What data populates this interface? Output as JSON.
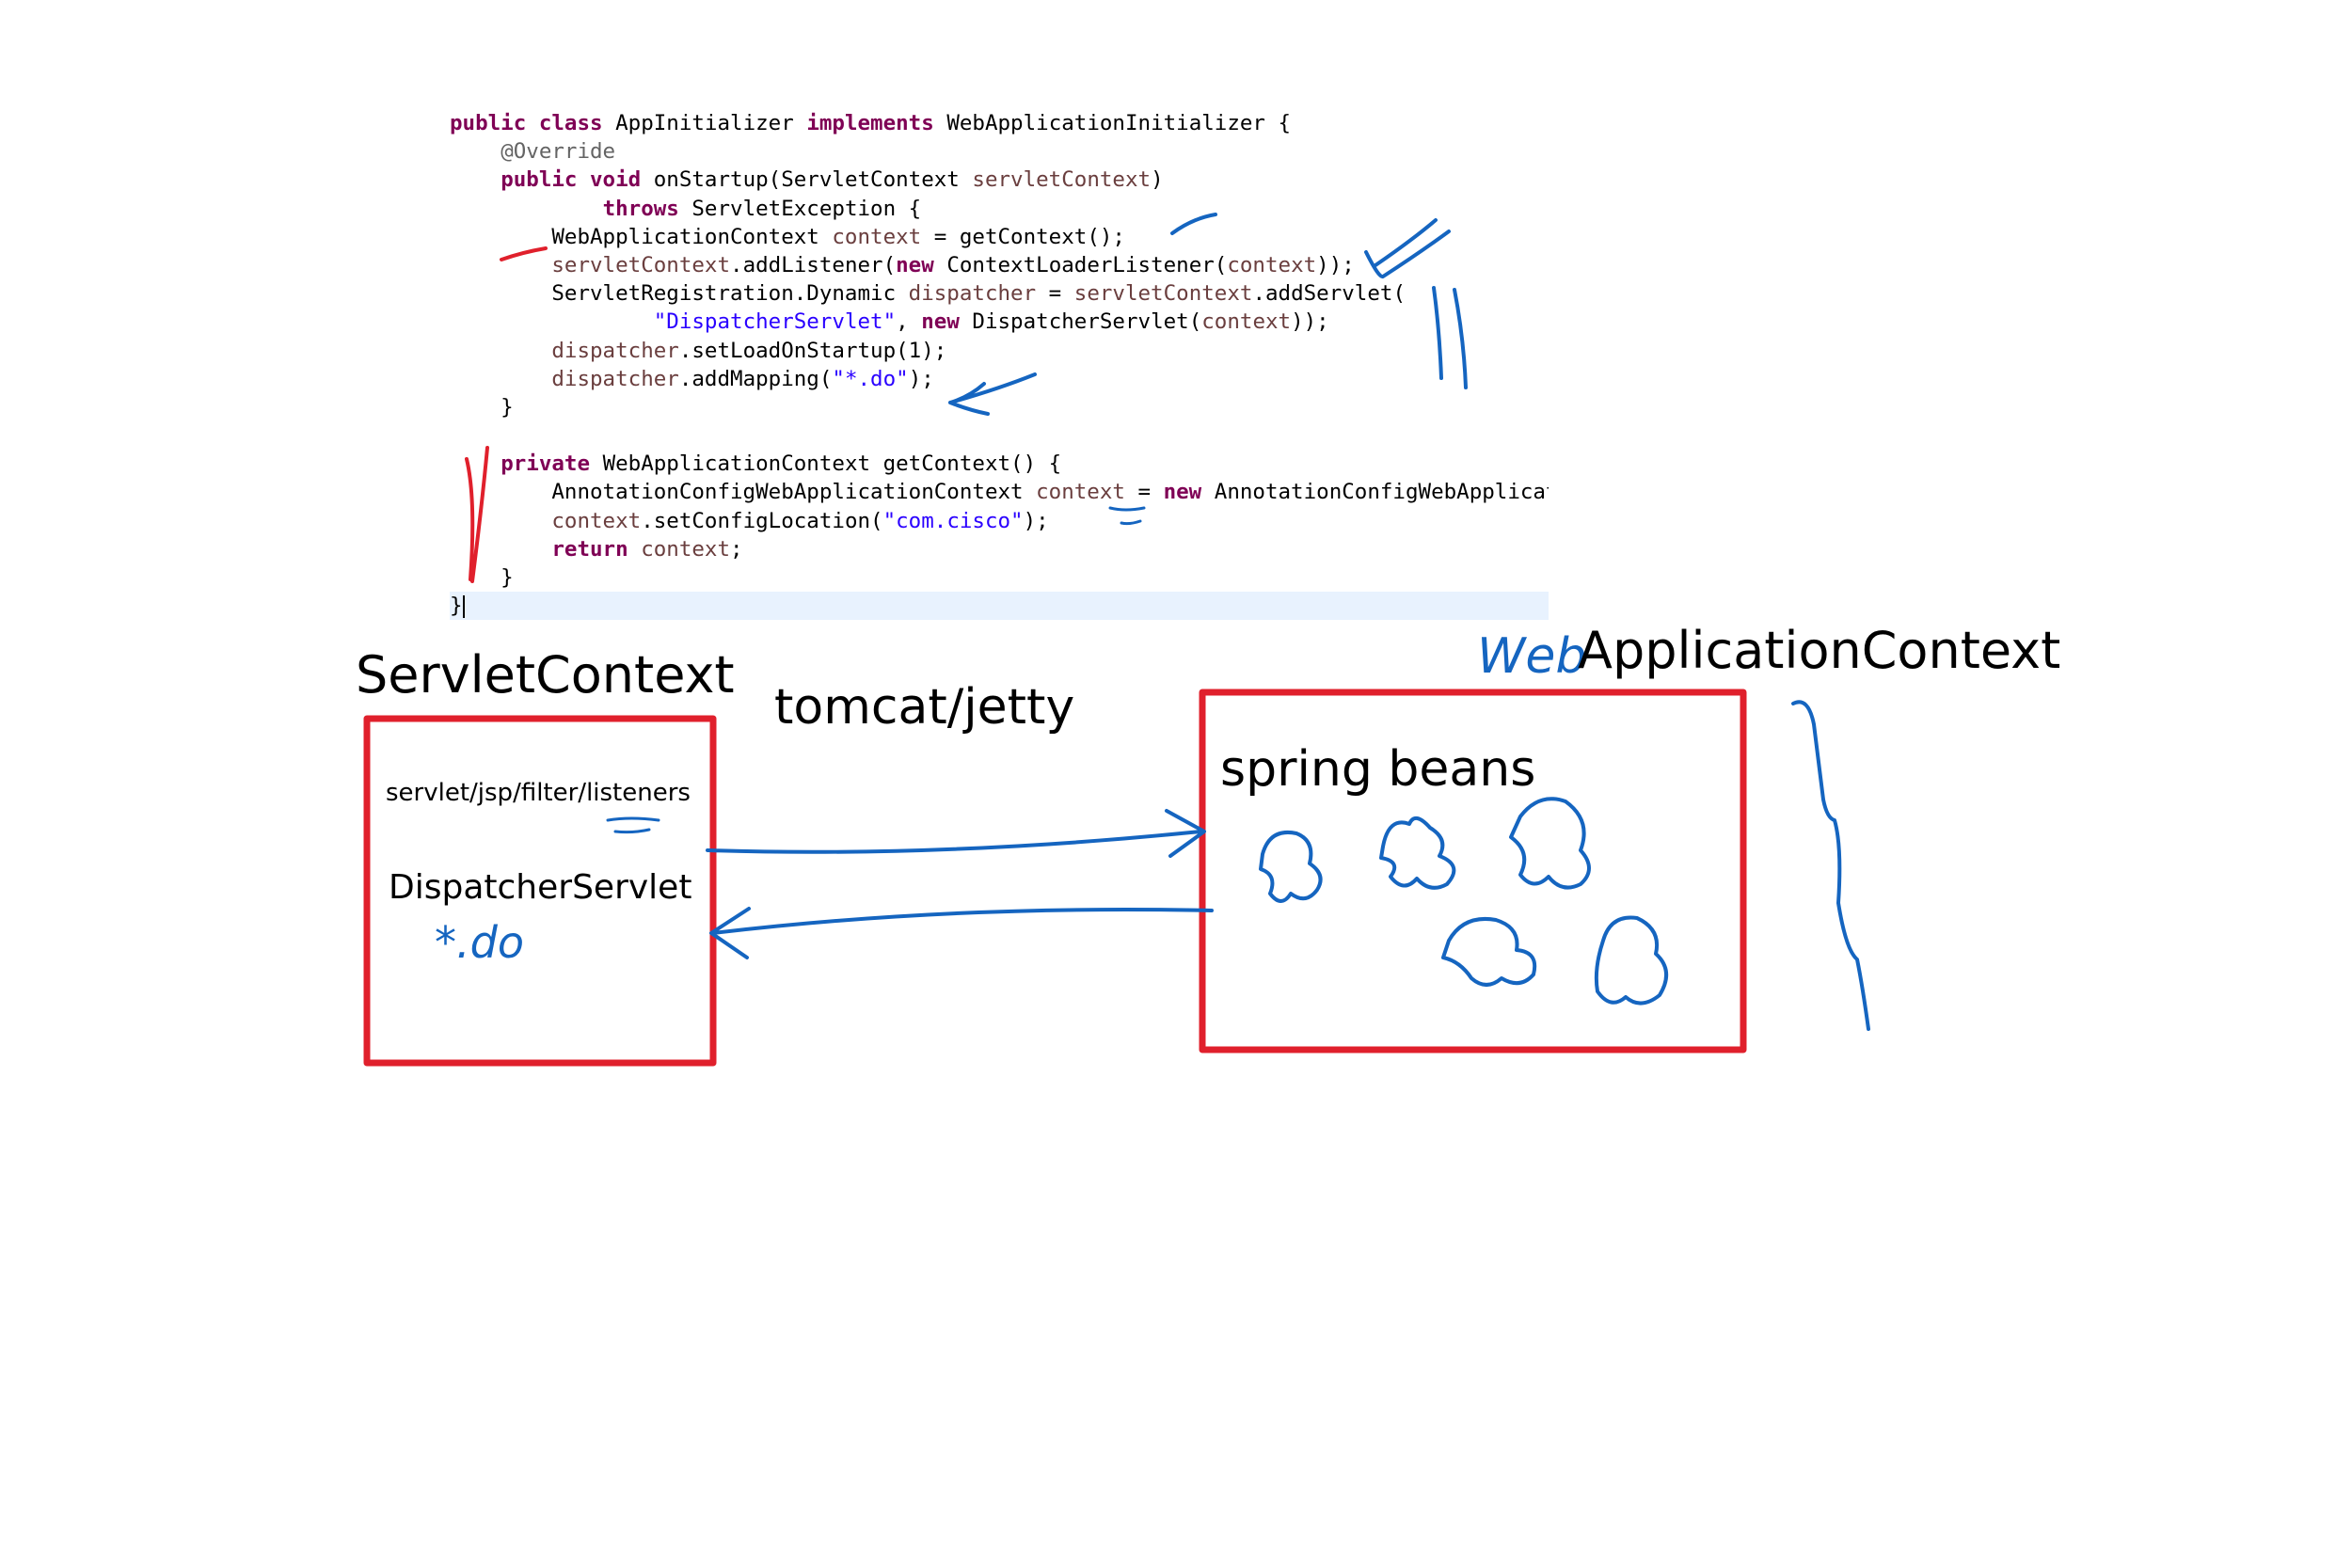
{
  "code": {
    "lines": [
      [
        {
          "t": "public ",
          "c": "kw"
        },
        {
          "t": "class ",
          "c": "kw"
        },
        {
          "t": "AppInitializer "
        },
        {
          "t": "implements ",
          "c": "kw"
        },
        {
          "t": "WebApplicationInitializer {"
        }
      ],
      [
        {
          "t": "    "
        },
        {
          "t": "@Override",
          "c": "ann"
        }
      ],
      [
        {
          "t": "    "
        },
        {
          "t": "public ",
          "c": "kw"
        },
        {
          "t": "void ",
          "c": "kw"
        },
        {
          "t": "onStartup(ServletContext "
        },
        {
          "t": "servletContext",
          "c": "var"
        },
        {
          "t": ")"
        }
      ],
      [
        {
          "t": "            "
        },
        {
          "t": "throws ",
          "c": "kw"
        },
        {
          "t": "ServletException {"
        }
      ],
      [
        {
          "t": "        WebApplicationContext "
        },
        {
          "t": "context",
          "c": "var"
        },
        {
          "t": " = getContext();"
        }
      ],
      [
        {
          "t": "        "
        },
        {
          "t": "servletContext",
          "c": "var"
        },
        {
          "t": ".addListener("
        },
        {
          "t": "new ",
          "c": "kw"
        },
        {
          "t": "ContextLoaderListener("
        },
        {
          "t": "context",
          "c": "var"
        },
        {
          "t": "));"
        }
      ],
      [
        {
          "t": "        ServletRegistration.Dynamic "
        },
        {
          "t": "dispatcher",
          "c": "var"
        },
        {
          "t": " = "
        },
        {
          "t": "servletContext",
          "c": "var"
        },
        {
          "t": ".addServlet("
        }
      ],
      [
        {
          "t": "                "
        },
        {
          "t": "\"DispatcherServlet\"",
          "c": "str"
        },
        {
          "t": ", "
        },
        {
          "t": "new ",
          "c": "kw"
        },
        {
          "t": "DispatcherServlet("
        },
        {
          "t": "context",
          "c": "var"
        },
        {
          "t": "));"
        }
      ],
      [
        {
          "t": "        "
        },
        {
          "t": "dispatcher",
          "c": "var"
        },
        {
          "t": ".setLoadOnStartup(1);"
        }
      ],
      [
        {
          "t": "        "
        },
        {
          "t": "dispatcher",
          "c": "var"
        },
        {
          "t": ".addMapping("
        },
        {
          "t": "\"*.do\"",
          "c": "str"
        },
        {
          "t": ");"
        }
      ],
      [
        {
          "t": "    }"
        }
      ],
      [
        {
          "t": ""
        }
      ],
      [
        {
          "t": "    "
        },
        {
          "t": "private ",
          "c": "kw"
        },
        {
          "t": "WebApplicationContext getContext() {"
        }
      ],
      [
        {
          "t": "        AnnotationConfigWebApplicationContext "
        },
        {
          "t": "context",
          "c": "var"
        },
        {
          "t": " = "
        },
        {
          "t": "new ",
          "c": "kw"
        },
        {
          "t": "AnnotationConfigWebApplicat"
        }
      ],
      [
        {
          "t": "        "
        },
        {
          "t": "context",
          "c": "var"
        },
        {
          "t": ".setConfigLocation("
        },
        {
          "t": "\"com.cisco\"",
          "c": "str"
        },
        {
          "t": ");"
        }
      ],
      [
        {
          "t": "        "
        },
        {
          "t": "return ",
          "c": "kw"
        },
        {
          "t": "context",
          "c": "var"
        },
        {
          "t": ";"
        }
      ],
      [
        {
          "t": "    }"
        }
      ],
      [
        {
          "t": "}"
        }
      ]
    ]
  },
  "diagram": {
    "servlet_context_title": "ServletContext",
    "container_label": "tomcat/jetty",
    "app_context_prefix": "Web",
    "app_context_title": "ApplicationContext",
    "servlet_context_items": "servlet/jsp/filter/listeners",
    "dispatcher_label": "DispatcherServlet",
    "mapping_note": "*.do",
    "beans_label": "spring beans"
  },
  "colors": {
    "box_border": "#e0202c",
    "ink_blue": "#1565c0",
    "ink_red": "#e0202c",
    "code_keyword": "#7f0055",
    "code_string": "#2a00ff",
    "code_variable": "#6a3e3e",
    "code_annotation": "#646464",
    "line_highlight": "#e8f2fe"
  }
}
